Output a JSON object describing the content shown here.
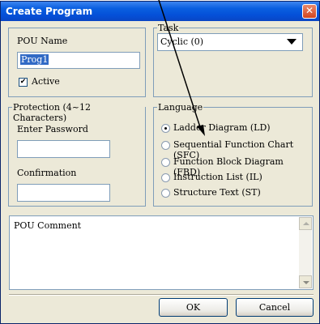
{
  "window": {
    "title": "Create Program",
    "close_glyph": "✕"
  },
  "pou": {
    "name_label": "POU Name",
    "name_value": "Prog1",
    "active_label": "Active",
    "active_checked": true
  },
  "task": {
    "legend": "Task",
    "selected": "Cyclic (0)"
  },
  "protection": {
    "legend": "Protection (4~12 Characters)",
    "password_label": "Enter Password",
    "password_value": "",
    "confirm_label": "Confirmation",
    "confirm_value": ""
  },
  "language": {
    "legend": "Language",
    "options": [
      {
        "label": "Ladder Diagram (LD)",
        "checked": true
      },
      {
        "label": "Sequential Function Chart (SFC)",
        "checked": false
      },
      {
        "label": "Function Block Diagram (FBD)",
        "checked": false
      },
      {
        "label": "Instruction List (IL)",
        "checked": false
      },
      {
        "label": "Structure Text (ST)",
        "checked": false
      }
    ]
  },
  "comment": {
    "label": "POU Comment"
  },
  "buttons": {
    "ok": "OK",
    "cancel": "Cancel"
  },
  "icons": {
    "close": "close-icon",
    "dropdown": "chevron-down-icon",
    "check": "check-icon"
  },
  "colors": {
    "title_bar": "#0a5fe0",
    "dialog_bg": "#ece9d8",
    "selection": "#316ac5",
    "close_button": "#d2451e"
  }
}
